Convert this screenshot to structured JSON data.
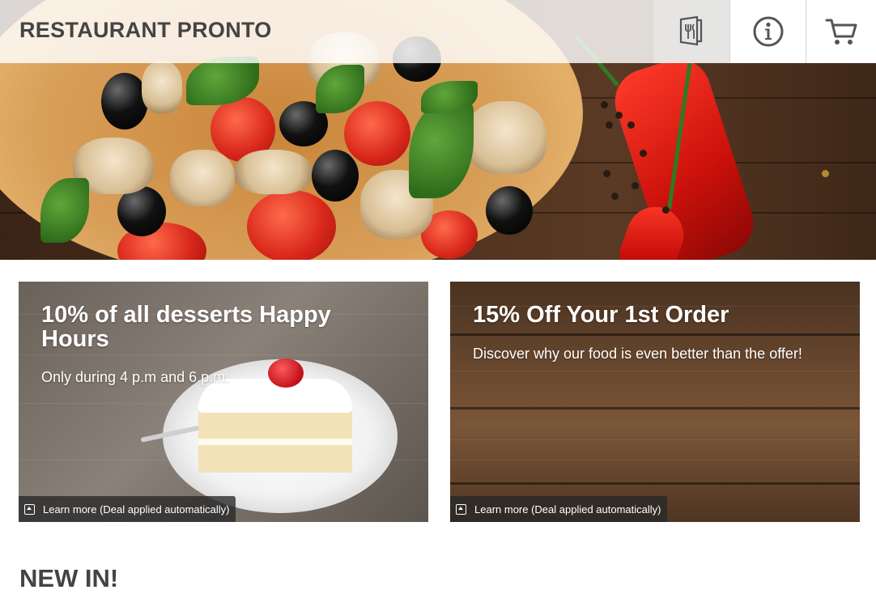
{
  "header": {
    "brand": "RESTAURANT PRONTO",
    "icons": [
      "menu-icon",
      "info-icon",
      "cart-icon"
    ]
  },
  "promos": [
    {
      "title": "10% of all desserts Happy Hours",
      "subtitle": "Only during 4 p.m and 6.p.m.",
      "link_label": "Learn more (Deal applied automatically)"
    },
    {
      "title": "15% Off Your 1st Order",
      "subtitle": "Discover why our food is even better than the offer!",
      "link_label": "Learn more (Deal applied automatically)"
    }
  ],
  "section": {
    "title": "NEW IN!"
  },
  "colors": {
    "brand_text": "#444444",
    "header_bg": "#ffffff",
    "overlay_dark": "#282828"
  }
}
